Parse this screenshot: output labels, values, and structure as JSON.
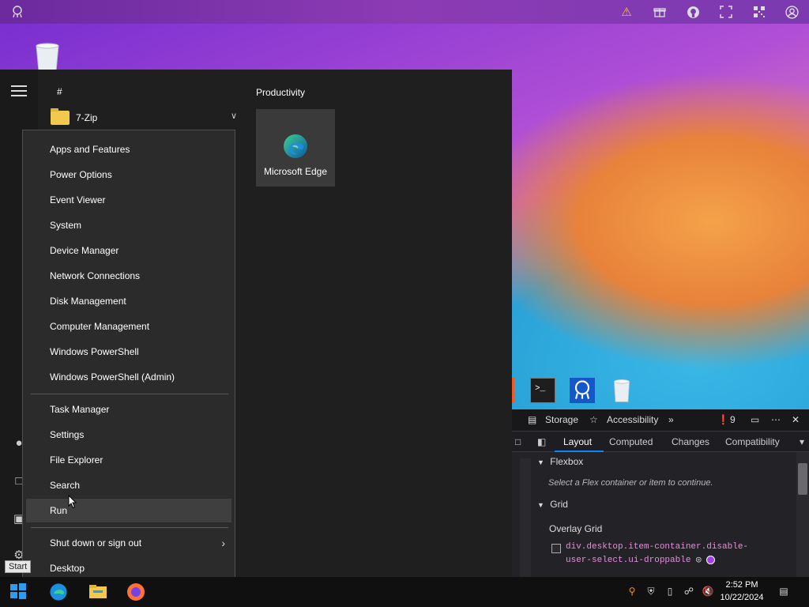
{
  "start_menu": {
    "apps_header": "#",
    "app_7zip": "7-Zip",
    "group_header": "Productivity",
    "tile_edge": "Microsoft Edge"
  },
  "context_menu": {
    "items": [
      "Apps and Features",
      "Power Options",
      "Event Viewer",
      "System",
      "Device Manager",
      "Network Connections",
      "Disk Management",
      "Computer Management",
      "Windows PowerShell",
      "Windows PowerShell (Admin)",
      "Task Manager",
      "Settings",
      "File Explorer",
      "Search",
      "Run",
      "Shut down or sign out",
      "Desktop"
    ]
  },
  "devtools": {
    "tabs": {
      "storage": "Storage",
      "accessibility": "Accessibility",
      "error_count": "9"
    },
    "subtabs": {
      "layout": "Layout",
      "computed": "Computed",
      "changes": "Changes",
      "compatibility": "Compatibility"
    },
    "flexbox": {
      "title": "Flexbox",
      "hint": "Select a Flex container or item to continue."
    },
    "grid": {
      "title": "Grid",
      "overlay_title": "Overlay Grid",
      "selector": "div.desktop.item-container.disable-user-select.ui-droppable"
    }
  },
  "taskbar": {
    "time": "2:52 PM",
    "date": "10/22/2024",
    "start_tooltip": "Start"
  },
  "colors": {
    "accent": "#0a84ff",
    "selector": "#e58fd8",
    "menu_bg": "#2b2b2b"
  }
}
